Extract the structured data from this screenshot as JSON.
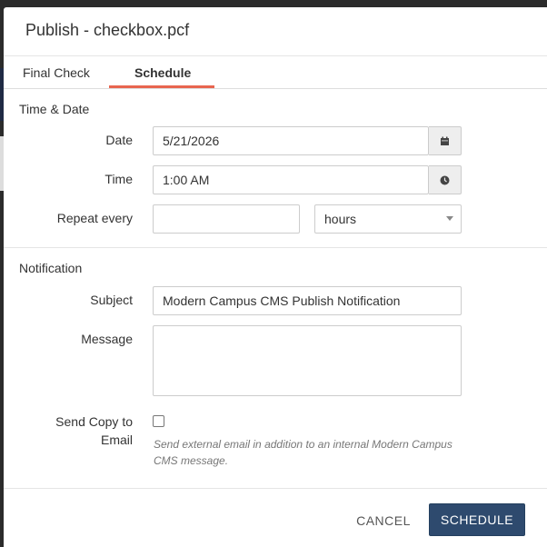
{
  "modal": {
    "title": "Publish - checkbox.pcf"
  },
  "tabs": [
    {
      "label": "Final Check",
      "active": false
    },
    {
      "label": "Schedule",
      "active": true
    }
  ],
  "time_date": {
    "section_label": "Time & Date",
    "date_label": "Date",
    "date_value": "5/21/2026",
    "date_icon": "calendar-icon",
    "time_label": "Time",
    "time_value": "1:00 AM",
    "time_icon": "clock-icon",
    "repeat_label": "Repeat every",
    "repeat_value": "",
    "repeat_unit": "hours"
  },
  "notification": {
    "section_label": "Notification",
    "subject_label": "Subject",
    "subject_value": "Modern Campus CMS Publish Notification",
    "message_label": "Message",
    "message_value": "",
    "send_copy_label_line1": "Send Copy to",
    "send_copy_label_line2": "Email",
    "send_copy_checked": false,
    "help_text": "Send external email in addition to an internal Modern Campus CMS message."
  },
  "footer": {
    "cancel_label": "CANCEL",
    "schedule_label": "SCHEDULE"
  },
  "colors": {
    "accent_tab": "#e8654f",
    "primary_button": "#2e4a6e"
  }
}
